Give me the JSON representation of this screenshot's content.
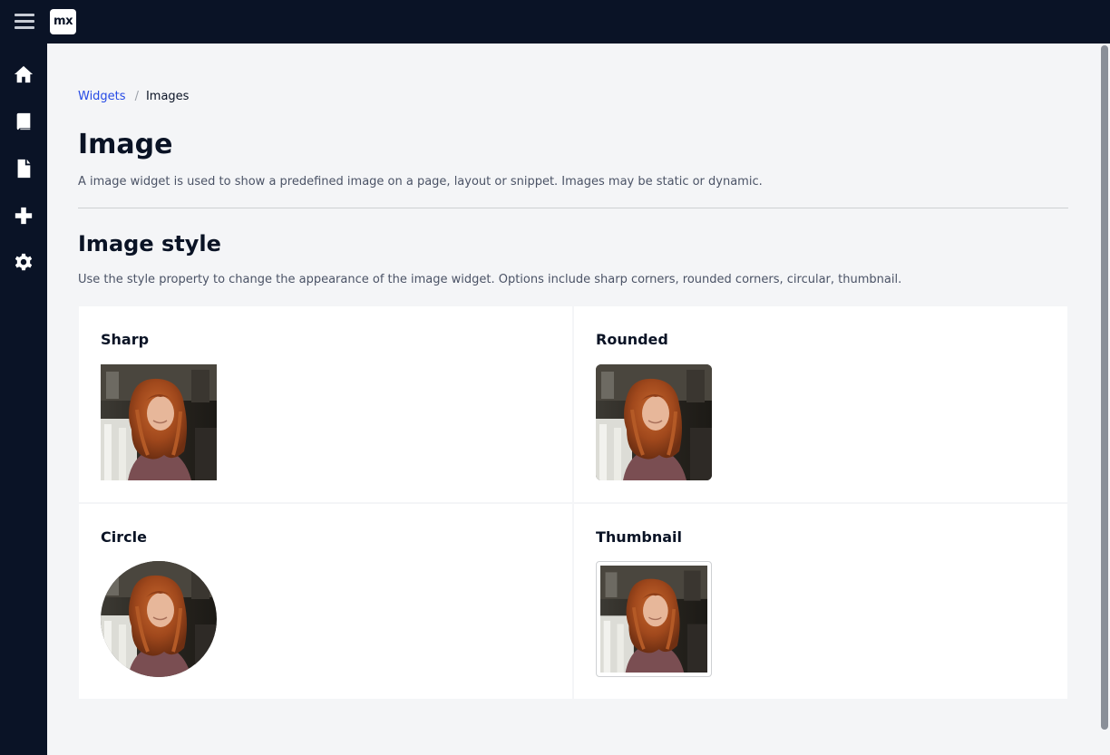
{
  "app": {
    "logo_text": "mx"
  },
  "topbar": {
    "menu_icon": "hamburger-icon"
  },
  "sidebar": {
    "items": [
      {
        "icon": "home-icon"
      },
      {
        "icon": "book-icon"
      },
      {
        "icon": "file-icon"
      },
      {
        "icon": "plus-icon"
      },
      {
        "icon": "gear-icon"
      }
    ]
  },
  "breadcrumb": {
    "parent": "Widgets",
    "separator": "/",
    "current": "Images"
  },
  "page": {
    "title": "Image",
    "description": "A image widget is used to show a predefined image on a page, layout or snippet. Images may be static or dynamic."
  },
  "section": {
    "title": "Image style",
    "description": "Use the style property to change the appearance of the image widget. Options include sharp corners, rounded corners, circular, thumbnail."
  },
  "cards": [
    {
      "title": "Sharp"
    },
    {
      "title": "Rounded"
    },
    {
      "title": "Circle"
    },
    {
      "title": "Thumbnail"
    }
  ],
  "colors": {
    "sidebar": "#0a1326",
    "link": "#264ae5",
    "background": "#f4f5f7"
  }
}
